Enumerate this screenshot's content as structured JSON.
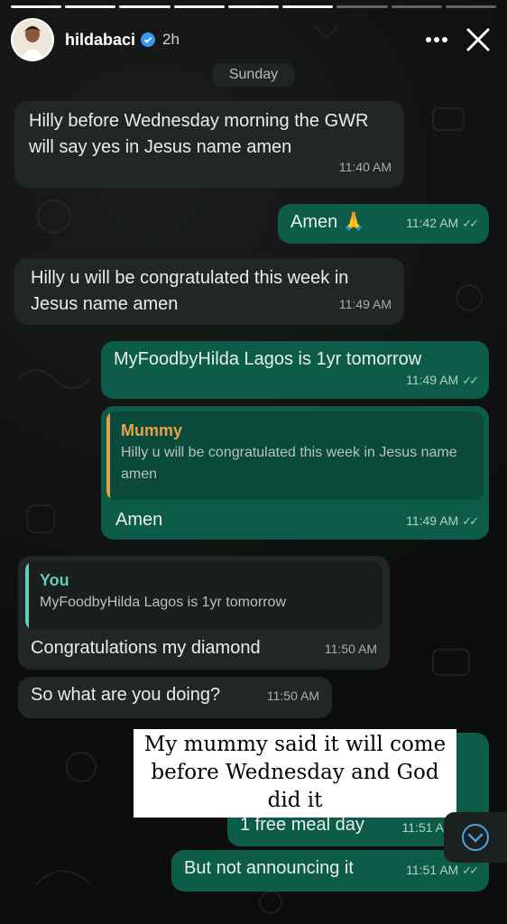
{
  "story": {
    "username": "hildabaci",
    "posted_ago": "2h",
    "segments_total": 9,
    "segments_done": 6
  },
  "chat": {
    "day_label": "Sunday",
    "messages": [
      {
        "direction": "in",
        "text": "Hilly before Wednesday morning the GWR will say yes in Jesus name amen",
        "time": "11:40 AM"
      },
      {
        "direction": "out",
        "text": "Amen",
        "emoji": "🙏",
        "time": "11:42 AM"
      },
      {
        "direction": "in",
        "text": "Hilly u will be congratulated this week in Jesus name amen",
        "time": "11:49 AM"
      },
      {
        "direction": "out",
        "text": "MyFoodbyHilda Lagos is 1yr tomorrow",
        "time": "11:49 AM"
      },
      {
        "direction": "out",
        "quote_author": "Mummy",
        "quote_text": "Hilly u will be congratulated this week in Jesus name amen",
        "text": "Amen",
        "time": "11:49 AM"
      },
      {
        "direction": "in",
        "quote_author": "You",
        "quote_text": "MyFoodbyHilda Lagos is 1yr tomorrow",
        "text": "Congratulations my diamond",
        "time": "11:50 AM"
      },
      {
        "direction": "in",
        "text": "So what are you doing?",
        "time": "11:50 AM"
      },
      {
        "direction": "out",
        "text": "1 free meal day",
        "time": "11:51 A"
      },
      {
        "direction": "out",
        "text": "But not announcing it",
        "time": "11:51 AM"
      }
    ]
  },
  "caption": "My mummy said it will come before Wednesday and God did it",
  "icons": {
    "verified": "verified-badge-icon",
    "more": "more-icon",
    "close": "close-icon",
    "read": "double-check-icon",
    "scroll": "chevron-down-icon"
  },
  "colors": {
    "incoming_bubble": "#232626",
    "outgoing_bubble": "#0d5c4a",
    "quote_accent_mummy": "#e8a14a",
    "quote_accent_you": "#5fcfb9",
    "verified": "#3897f0"
  }
}
